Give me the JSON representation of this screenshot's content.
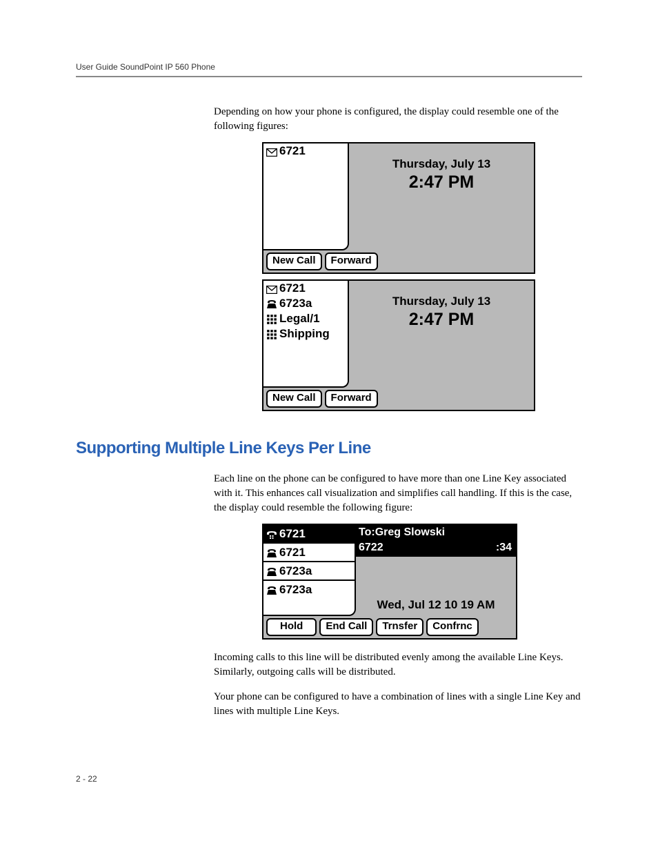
{
  "header": "User Guide SoundPoint IP 560 Phone",
  "intro_para": "Depending on how your phone is configured, the display could resemble one of the following figures:",
  "fig1": {
    "line1": "6721",
    "date": "Thursday, July 13",
    "time": "2:47 PM",
    "sk1": "New Call",
    "sk2": "Forward"
  },
  "fig2": {
    "line1": "6721",
    "line2": "6723a",
    "line3": "Legal/1",
    "line4": "Shipping",
    "date": "Thursday, July 13",
    "time": "2:47 PM",
    "sk1": "New Call",
    "sk2": "Forward"
  },
  "section_heading": "Supporting Multiple Line Keys Per Line",
  "section_para": "Each line on the phone can be configured to have more than one Line Key associated with it. This enhances call visualization and simplifies call handling. If this is the case, the display could resemble the following figure:",
  "fig3": {
    "line1": "6721",
    "line2": "6721",
    "line3": "6723a",
    "line4": "6723a",
    "call_to": "To:Greg Slowski",
    "call_num": "6722",
    "call_time": ":34",
    "datetime": "Wed, Jul 12  10 19 AM",
    "sk1": "Hold",
    "sk2": "End Call",
    "sk3": "Trnsfer",
    "sk4": "Confrnc"
  },
  "after_para1": "Incoming calls to this line will be distributed evenly among the available Line Keys. Similarly, outgoing calls will be distributed.",
  "after_para2": "Your phone can be configured to have a combination of lines with a single Line Key and lines with multiple Line Keys.",
  "page_num": "2 - 22"
}
